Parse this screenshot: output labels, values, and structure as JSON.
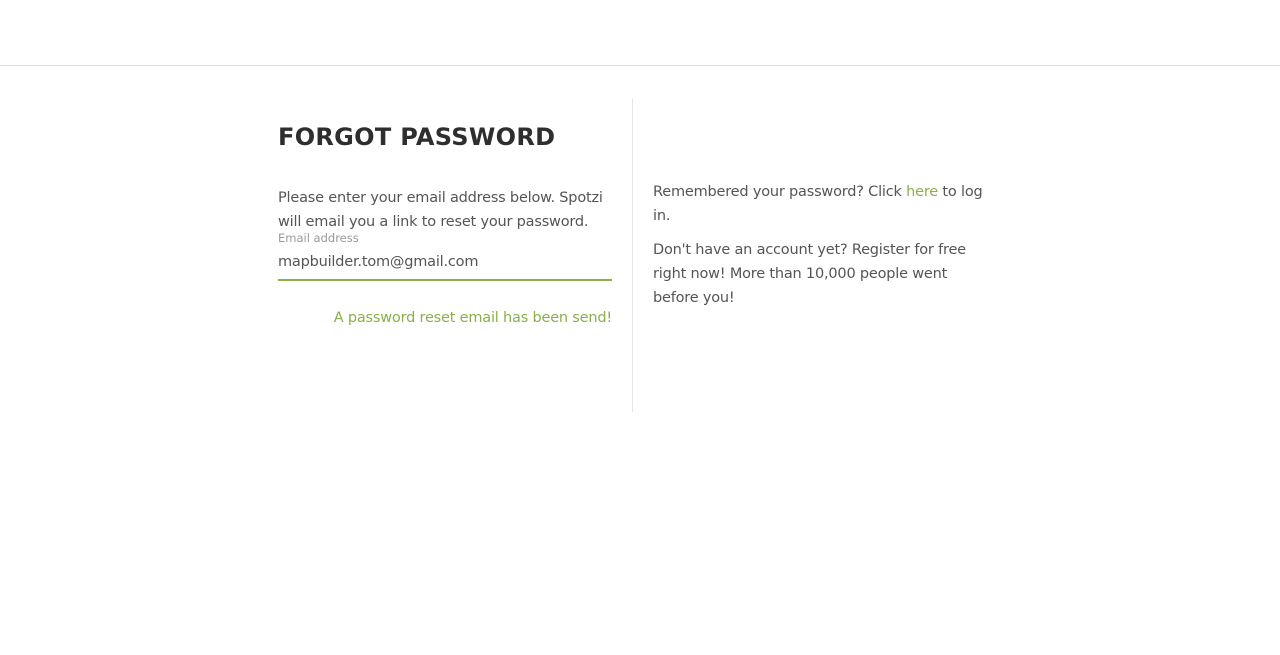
{
  "forgot": {
    "title": "FORGOT PASSWORD",
    "intro": "Please enter your email address below. Spotzi will email you a link to reset your password.",
    "email_label": "Email address",
    "email_value": "mapbuilder.tom@gmail.com",
    "status_message": "A password reset email has been send!"
  },
  "side": {
    "remembered_prefix": "Remembered your password? Click ",
    "remembered_link": "here",
    "remembered_suffix": " to log in.",
    "register_text": "Don't have an account yet? Register for free right now! More than 10,000 people went before you!"
  },
  "colors": {
    "accent": "#8ab04a",
    "text": "#555555",
    "heading": "#2e2e2e",
    "divider": "#e6e6e6"
  }
}
